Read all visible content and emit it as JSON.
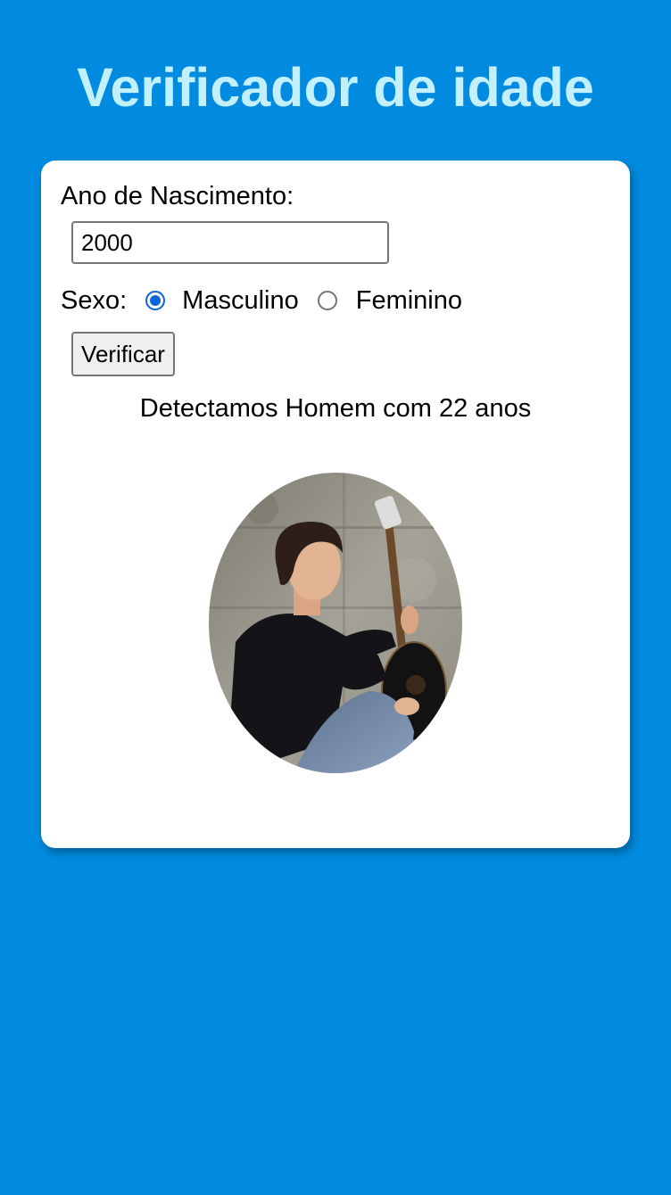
{
  "page": {
    "title": "Verificador de idade"
  },
  "form": {
    "year_label": "Ano de Nascimento:",
    "year_value": "2000",
    "sex_label": "Sexo:",
    "sex_options": [
      {
        "label": "Masculino",
        "checked": true
      },
      {
        "label": "Feminino",
        "checked": false
      }
    ],
    "submit_label": "Verificar"
  },
  "result": {
    "text": "Detectamos Homem com 22 anos",
    "image": "young man with guitar seated against concrete wall"
  },
  "colors": {
    "background": "#018be0",
    "title": "#c3f0ff",
    "card": "#ffffff",
    "radio_accent": "#0b66d8"
  }
}
